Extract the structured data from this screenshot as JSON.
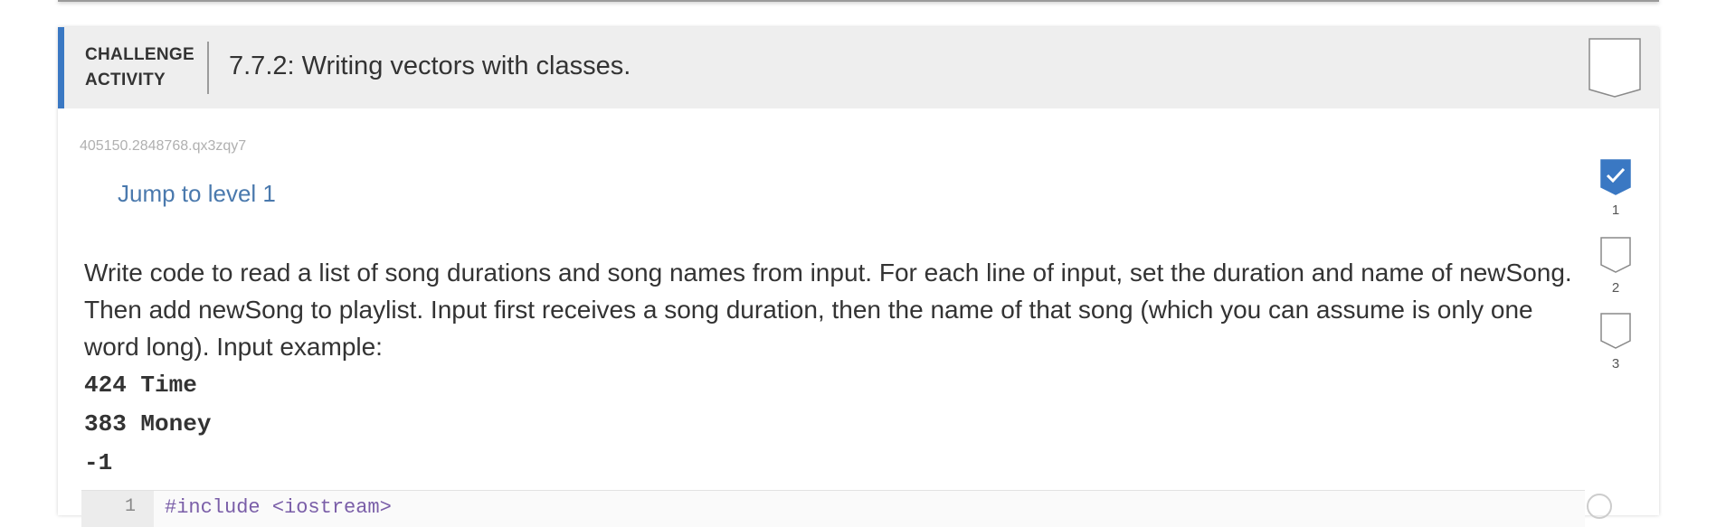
{
  "header": {
    "challenge_label_line1": "CHALLENGE",
    "challenge_label_line2": "ACTIVITY",
    "title": "7.7.2: Writing vectors with classes."
  },
  "activity_id": "405150.2848768.qx3zqy7",
  "jump_link": "Jump to level 1",
  "instructions": "Write code to read a list of song durations and song names from input. For each line of input, set the duration and name of newSong. Then add newSong to playlist. Input first receives a song duration, then the name of that song (which you can assume is only one word long). Input example:",
  "input_example": [
    "424 Time",
    "383 Money",
    "-1"
  ],
  "levels": [
    {
      "number": "1",
      "status": "completed"
    },
    {
      "number": "2",
      "status": "incomplete"
    },
    {
      "number": "3",
      "status": "incomplete"
    }
  ],
  "editor": {
    "line_number": "1",
    "first_line": "#include <iostream>"
  },
  "colors": {
    "accent": "#3a78c3",
    "link": "#4a79ad",
    "header_bg": "#eeeeee"
  }
}
